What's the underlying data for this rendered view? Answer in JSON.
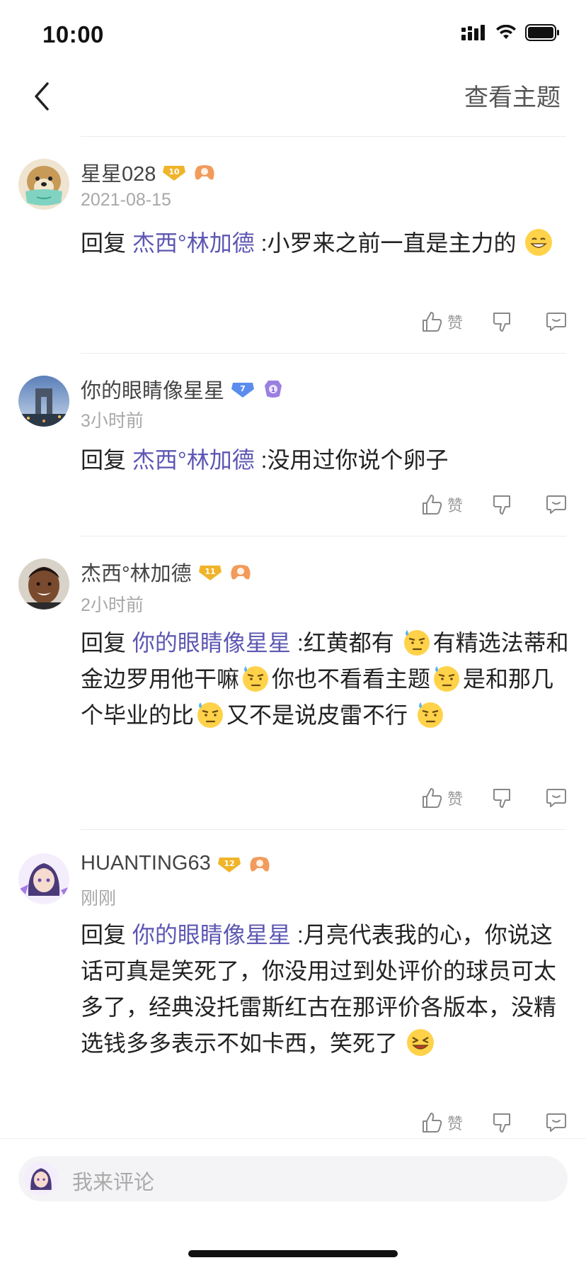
{
  "status": {
    "time": "10:00"
  },
  "nav": {
    "view_topic": "查看主题"
  },
  "reply_prefix": "回复",
  "like_label": "赞",
  "comments": [
    {
      "username": "星星028",
      "level": "10",
      "timestamp": "2021-08-15",
      "mention": "杰西°林加德",
      "text": [
        " :小罗来之前一直是主力的"
      ]
    },
    {
      "username": "你的眼睛像星星",
      "level": "7",
      "timestamp": "3小时前",
      "mention": "杰西°林加德",
      "text": [
        " :没用过你说个卵子"
      ]
    },
    {
      "username": "杰西°林加德",
      "level": "11",
      "timestamp": "2小时前",
      "mention": "你的眼睛像星星",
      "text": [
        " :红黄都有",
        "有精选法蒂和金边罗用他干嘛",
        "你也不看看主题",
        "是和那几个毕业的比",
        "又不是说皮雷不行"
      ]
    },
    {
      "username": "HUANTING63",
      "level": "12",
      "timestamp": "刚刚",
      "mention": "你的眼睛像星星",
      "text": [
        " :月亮代表我的心，你说这话可真是笑死了，你没用过到处评价的球员可太多了，经典没托雷斯红古在那评价各版本，没精选钱多多表示不如卡西，笑死了"
      ]
    }
  ],
  "comment_bar": {
    "placeholder": "我来评论"
  },
  "colors": {
    "mention": "#5d57b3",
    "gold_badge": "#f0b429",
    "blue_badge": "#5b8def",
    "game_badge": "#f29b5c"
  },
  "icons": [
    "signal-icon",
    "wifi-icon",
    "battery-icon",
    "back-icon",
    "thumbs-up-icon",
    "thumbs-down-icon",
    "comment-icon",
    "grin-emoji",
    "sweat-emoji",
    "laugh-emoji"
  ]
}
